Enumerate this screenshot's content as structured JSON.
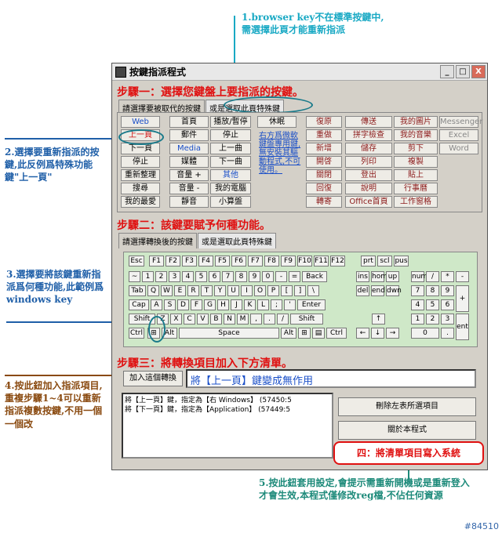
{
  "annotations": {
    "a1": "1.browser key不在標準按鍵中,需選擇此頁才能重新指派",
    "a2": "2.選擇要重新指派的按鍵,此反例爲特殊功能鍵\"上一頁\"",
    "a3": "3.選擇要將該鍵重新指派爲何種功能,此範例爲windows key",
    "a4": "4.按此鈕加入指派項目,重複步驟1~4可以重新指派複數按鍵,不用一個一個改",
    "a5": "5.按此鈕套用設定,會提示需重新開機或是重新登入才會生效,本程式僅修改reg檔,不佔任何資源"
  },
  "watermark": "#84510",
  "window": {
    "title": "按鍵指派程式",
    "min": "_",
    "max": "□",
    "close": "X"
  },
  "step1": {
    "title": "步驟一：選擇您鍵盤上要指派的按鍵。",
    "tabs": [
      "請選擇要被取代的按鍵",
      "或是選取此頁特殊鍵"
    ]
  },
  "special_keys": {
    "col1": [
      "Web",
      "上一頁",
      "下一頁",
      "停止",
      "重新整理",
      "搜尋",
      "我的最愛"
    ],
    "col2": [
      "首頁",
      "郵件",
      "Media",
      "媒體",
      "音量 +",
      "音量 -",
      "靜音"
    ],
    "col3": [
      "播放/暫停",
      "停止",
      "上一曲",
      "下一曲",
      "其他",
      "我的電腦",
      "小算盤"
    ],
    "col4": [
      "休眠"
    ],
    "note": "右方爲微軟鍵盤專用鍵,無安裝其驅動程式,不可使用。",
    "col5": [
      "復原",
      "重做",
      "新增",
      "開啓",
      "關閉",
      "回復",
      "轉寄"
    ],
    "col6": [
      "傳送",
      "拼字檢查",
      "儲存",
      "列印",
      "登出",
      "說明",
      "Office首頁"
    ],
    "col7": [
      "我的圖片",
      "我的音樂",
      "剪下",
      "複製",
      "貼上",
      "行事曆",
      "工作窗格"
    ],
    "col8": [
      "Messenger",
      "Excel",
      "Word"
    ]
  },
  "step2": {
    "title": "步驟二：該鍵要賦予何種功能。",
    "tabs": [
      "請選擇轉換後的按鍵",
      "或是選取此頁特殊鍵"
    ]
  },
  "keyboard": {
    "fn_row": [
      "Esc",
      "F1",
      "F2",
      "F3",
      "F4",
      "F5",
      "F6",
      "F7",
      "F8",
      "F9",
      "F10",
      "F11",
      "F12",
      "prt",
      "scl",
      "pus"
    ],
    "row1": [
      "~",
      "1",
      "2",
      "3",
      "4",
      "5",
      "6",
      "7",
      "8",
      "9",
      "0",
      "-",
      "=",
      "Back"
    ],
    "row2": [
      "Tab",
      "Q",
      "W",
      "E",
      "R",
      "T",
      "Y",
      "U",
      "I",
      "O",
      "P",
      "[",
      "]",
      "\\"
    ],
    "row3": [
      "Cap",
      "A",
      "S",
      "D",
      "F",
      "G",
      "H",
      "J",
      "K",
      "L",
      ";",
      "'",
      "Enter"
    ],
    "row4": [
      "Shift",
      "Z",
      "X",
      "C",
      "V",
      "B",
      "N",
      "M",
      ",",
      ".",
      "/",
      "Shift"
    ],
    "row5": [
      "Ctrl",
      "⊞",
      "Alt",
      "Space",
      "Alt",
      "⊞",
      "▤",
      "Ctrl"
    ],
    "nav1": [
      "ins",
      "hom",
      "up"
    ],
    "nav2": [
      "del",
      "end",
      "dwn"
    ],
    "arrows": [
      "↑",
      "←",
      "↓",
      "→"
    ],
    "num1": [
      "num",
      "/",
      "*",
      "-"
    ],
    "num2": [
      "7",
      "8",
      "9",
      "+"
    ],
    "num3": [
      "4",
      "5",
      "6"
    ],
    "num4": [
      "1",
      "2",
      "3",
      "ent"
    ],
    "num5": [
      "0",
      "."
    ]
  },
  "step3": {
    "title": "步驟三：將轉換項目加入下方清單。",
    "add_button": "加入這個轉換",
    "result": "將【上一頁】鍵變成無作用"
  },
  "list": [
    "將【上一頁】鍵，指定為【右 Windows】 (57450:5",
    "將【下一頁】鍵，指定為【Application】 (57449:5"
  ],
  "buttons": {
    "delete": "刪除左表所選項目",
    "about": "關於本程式",
    "apply": "四：將清單項目寫入系統"
  }
}
